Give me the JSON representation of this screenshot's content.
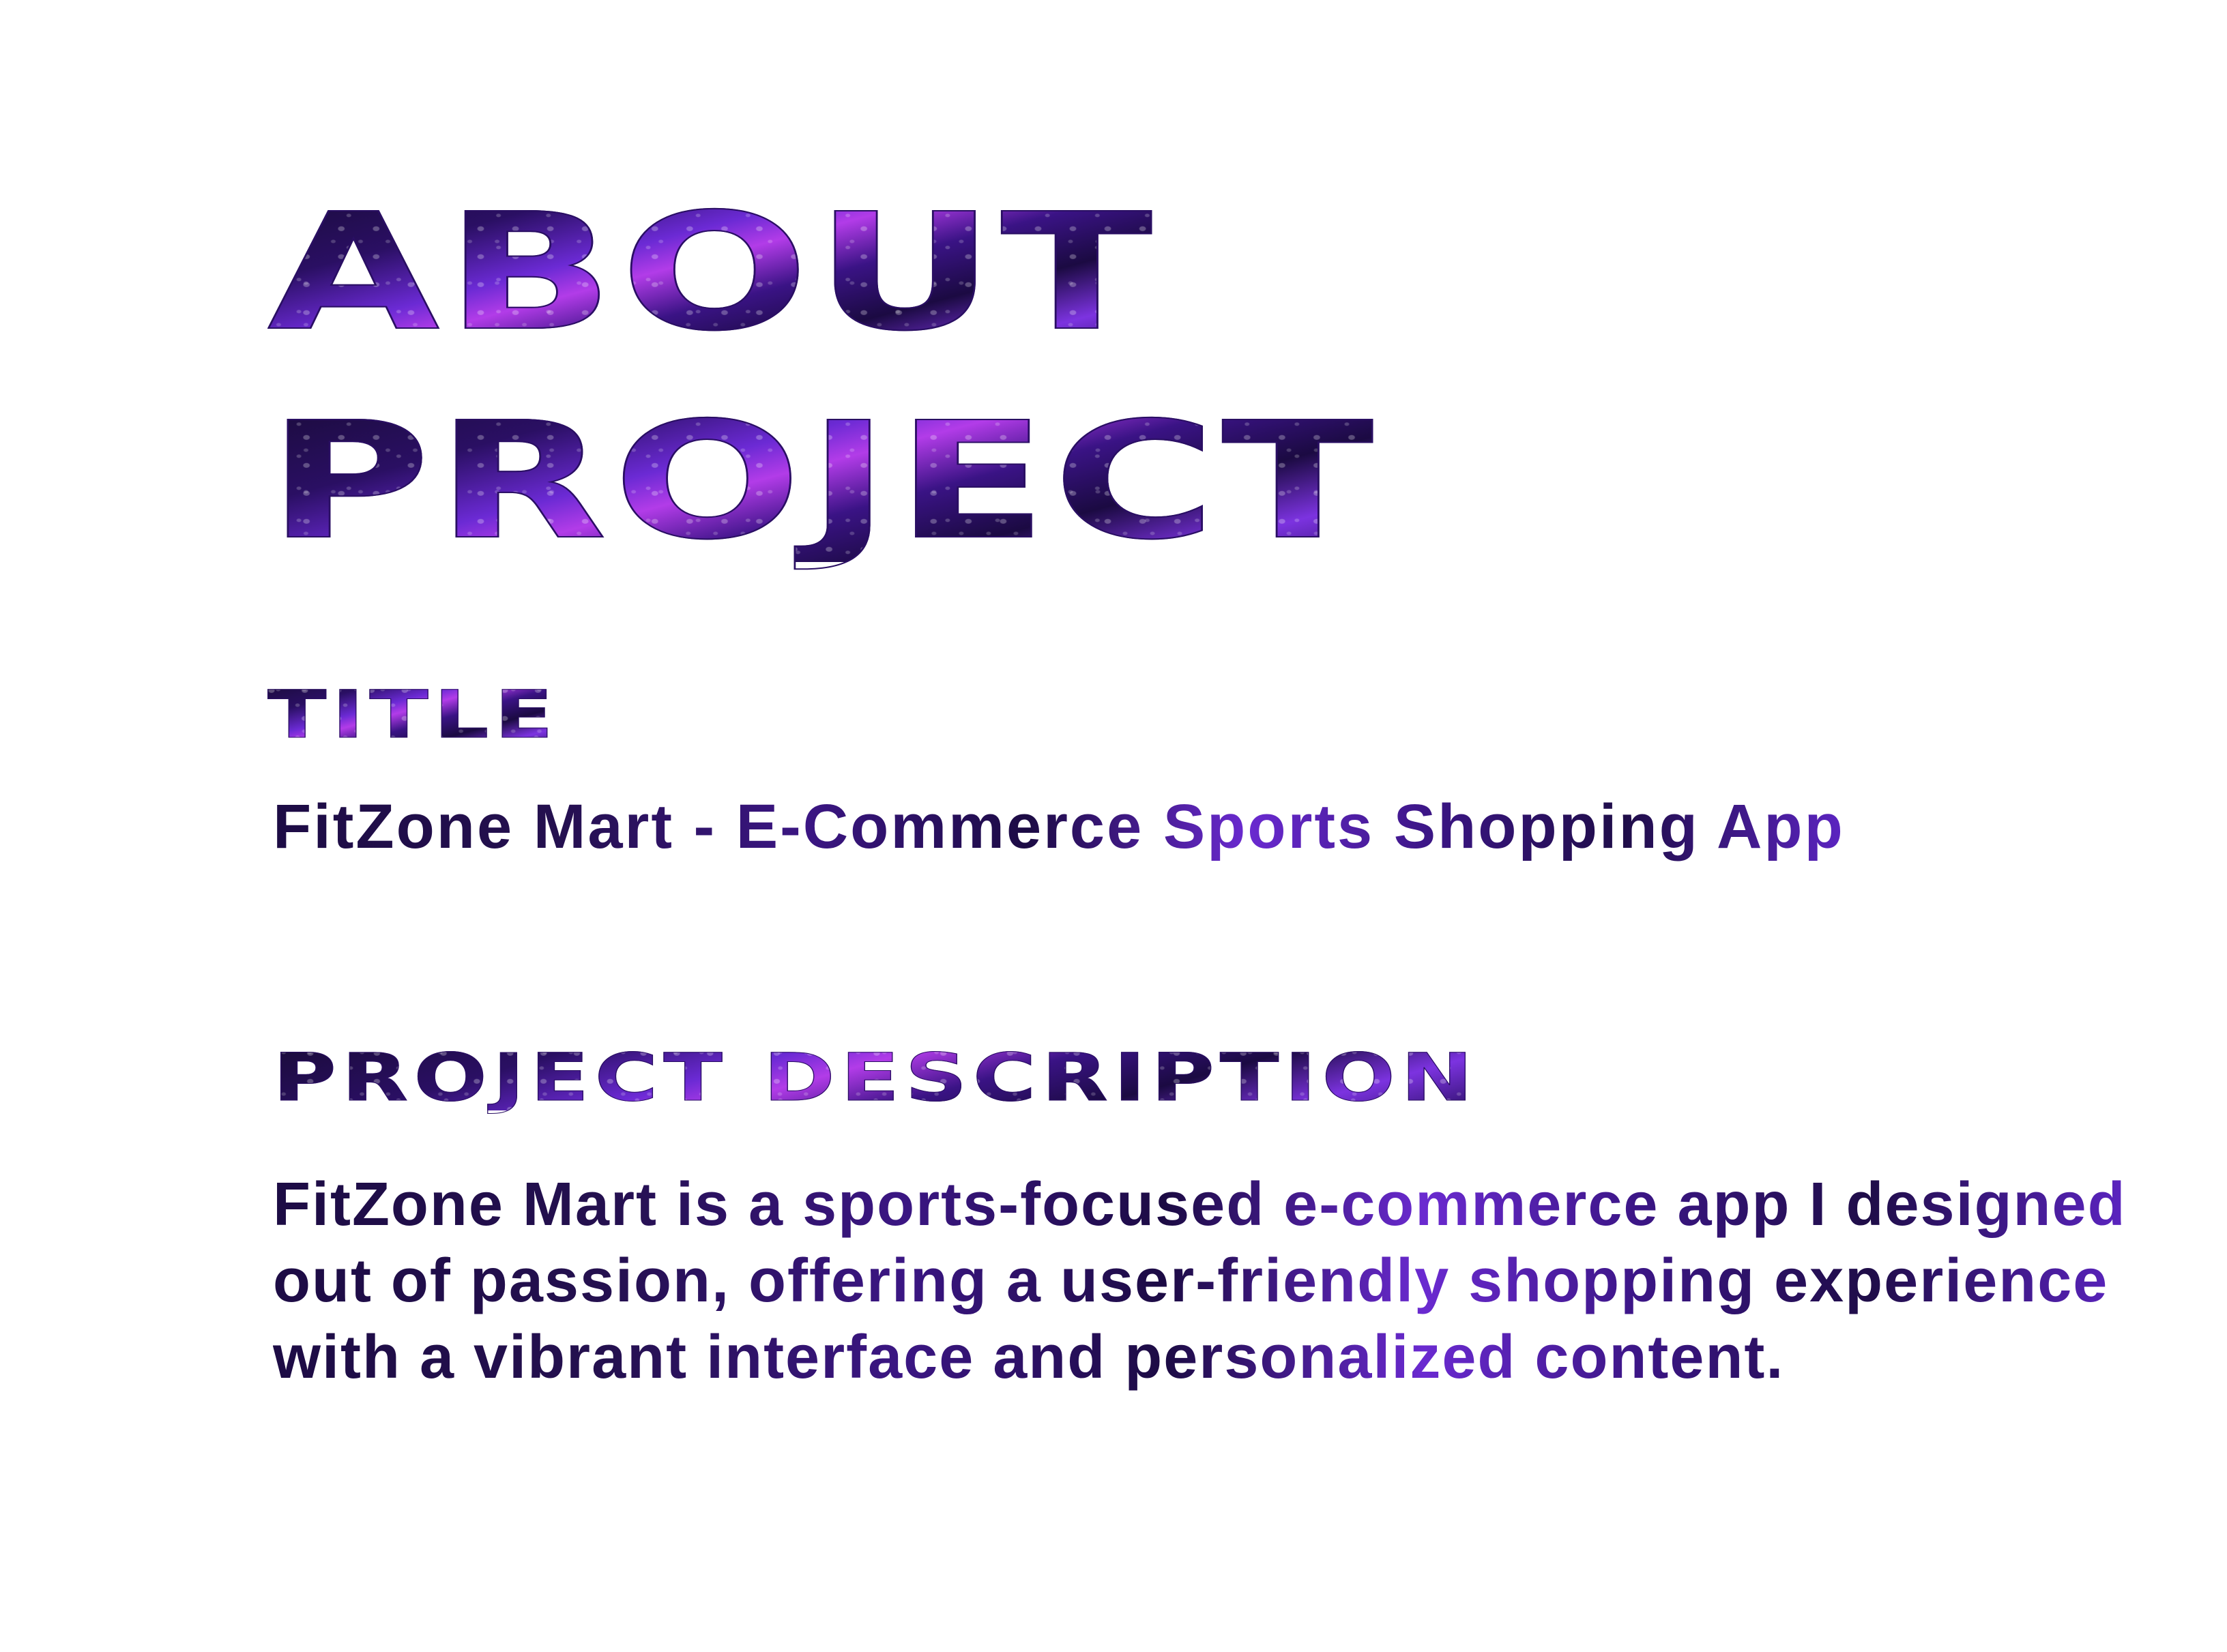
{
  "hero": {
    "line1": "ABOUT",
    "line2": "PROJECT"
  },
  "title_section": {
    "heading": "TITLE",
    "value": "FitZone Mart - E-Commerce Sports Shopping App"
  },
  "description_section": {
    "heading": "PROJECT DESCRIPTION",
    "body": "FitZone Mart is a sports-focused e-commerce app I designed out of passion, offering a user-friendly shopping experience with a vibrant interface and personalized content."
  },
  "colors": {
    "background": "#ffffff",
    "text_dark": "#1d0c45",
    "accent_purple": "#6b2ad4",
    "accent_violet": "#b23ce8"
  }
}
